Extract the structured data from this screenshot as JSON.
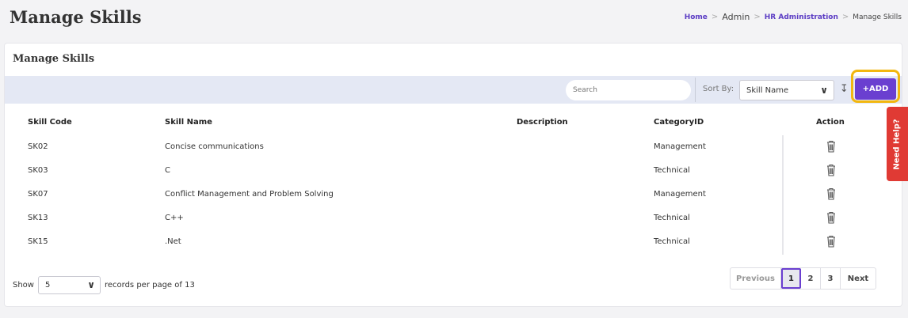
{
  "page": {
    "title": "Manage Skills"
  },
  "breadcrumb": {
    "items": [
      "Home",
      "Admin",
      "HR Administration",
      "Manage Skills"
    ],
    "separator": ">"
  },
  "card": {
    "title": "Manage Skills"
  },
  "toolbar": {
    "search_placeholder": "Search",
    "sort_label": "Sort By:",
    "sort_value": "Skill Name",
    "sort_icon": "sort-order-icon",
    "add_label": "+ADD",
    "accent_color": "#6a3fd0",
    "highlight_color": "#f2b70f"
  },
  "table": {
    "columns": [
      "Skill Code",
      "Skill Name",
      "Description",
      "CategoryID",
      "Action"
    ],
    "rows": [
      {
        "code": "SK02",
        "name": "Concise communications",
        "description": "",
        "category": "Management"
      },
      {
        "code": "SK03",
        "name": "C",
        "description": "",
        "category": "Technical"
      },
      {
        "code": "SK07",
        "name": "Conflict Management and Problem Solving",
        "description": "",
        "category": "Management"
      },
      {
        "code": "SK13",
        "name": "C++",
        "description": "",
        "category": "Technical"
      },
      {
        "code": "SK15",
        "name": ".Net",
        "description": "",
        "category": "Technical"
      }
    ],
    "action_icon": "trash-icon"
  },
  "footer": {
    "show_label": "Show",
    "page_size": "5",
    "records_text": "records per page of 13"
  },
  "pagination": {
    "previous": "Previous",
    "pages": [
      "1",
      "2",
      "3"
    ],
    "current": "1",
    "next": "Next"
  },
  "help_tab": {
    "label": "Need Help?",
    "color": "#e03a34"
  }
}
